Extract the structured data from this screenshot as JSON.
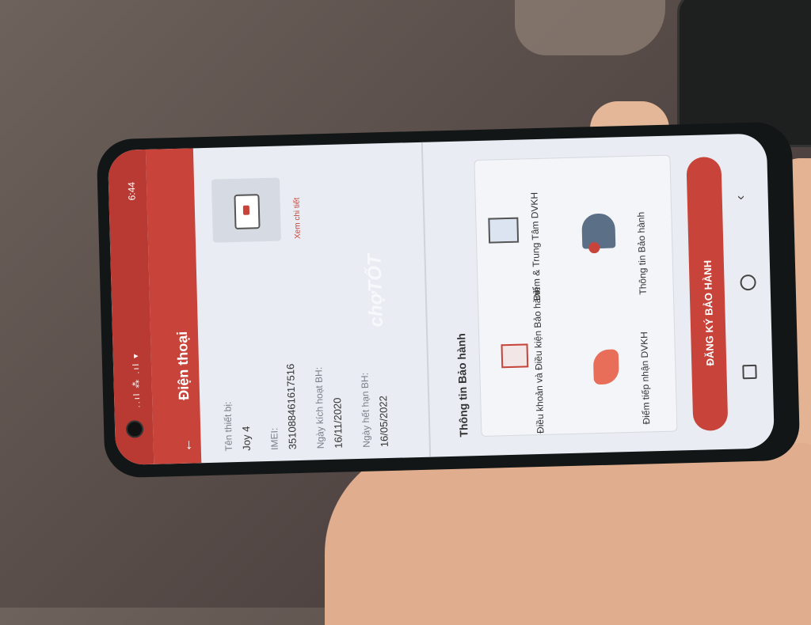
{
  "status": {
    "time": "6:44",
    "icons": "..ıl ⁂ .ıl ▾"
  },
  "header": {
    "title": "Điện thoại",
    "back_icon": "arrow-left-icon"
  },
  "device": {
    "detail_link": "Xem chi tiết",
    "fields": [
      {
        "label": "Tên thiết bị:",
        "value": "Joy 4"
      },
      {
        "label": "IMEI:",
        "value": "351088461617516"
      },
      {
        "label": "Ngày kích hoạt BH:",
        "value": "16/11/2020"
      },
      {
        "label": "Ngày hết hạn BH:",
        "value": "16/05/2022"
      }
    ]
  },
  "warranty": {
    "section_title": "Thông tin Bảo hành",
    "tiles": [
      {
        "label": "Điều khoản và Điều kiện Bảo hành",
        "icon": "document-icon"
      },
      {
        "label": "Điểm & Trung Tâm DVKH",
        "icon": "map-pin-tablet-icon"
      },
      {
        "label": "Điểm tiếp nhận DVKH",
        "icon": "phone-hand-icon"
      },
      {
        "label": "Thông tin Bảo hành",
        "icon": "support-person-icon"
      }
    ],
    "cta_label": "ĐĂNG KÝ BẢO HÀNH"
  },
  "watermark": "chợTỐT",
  "navbar": {
    "back": "‹",
    "home": "home-icon",
    "recent": "recent-apps-icon"
  }
}
